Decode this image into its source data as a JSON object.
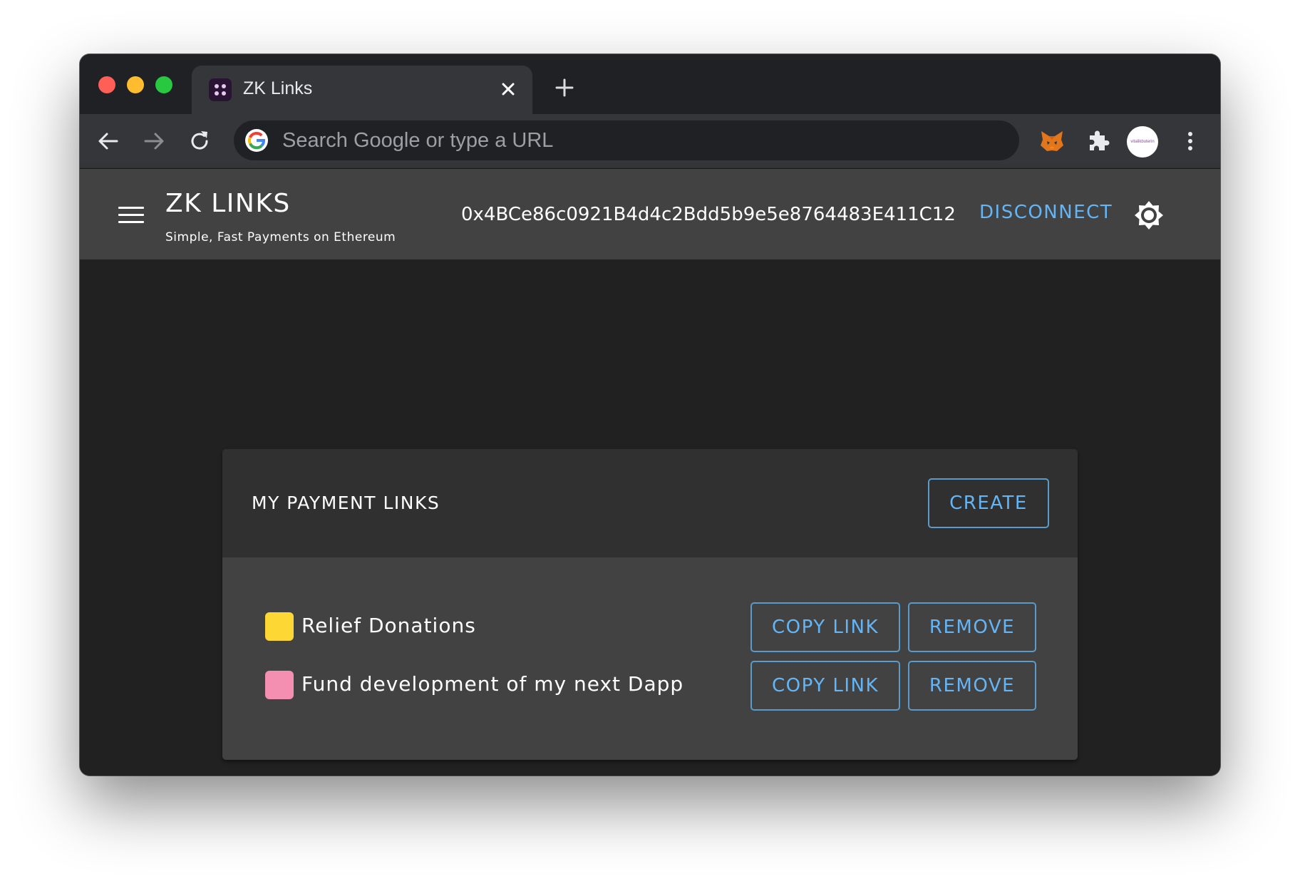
{
  "browser": {
    "tab_title": "ZK Links",
    "omnibox_placeholder": "Search Google or type a URL",
    "avatar_text": "vitalikbuterin"
  },
  "app": {
    "title": "ZK LINKS",
    "subtitle": "Simple, Fast Payments on Ethereum",
    "wallet_address": "0x4BCe86c0921B4d4c2Bdd5b9e5e8764483E411C12",
    "disconnect_label": "DISCONNECT"
  },
  "card": {
    "title": "MY PAYMENT LINKS",
    "create_label": "CREATE",
    "links": [
      {
        "name": "Relief Donations",
        "color": "#fdd835",
        "copy_label": "COPY LINK",
        "remove_label": "REMOVE"
      },
      {
        "name": "Fund development of my next Dapp",
        "color": "#f48fb1",
        "copy_label": "COPY LINK",
        "remove_label": "REMOVE"
      }
    ]
  },
  "colors": {
    "accent": "#64b5f6",
    "appbar": "#424242",
    "background": "#212121"
  },
  "icons": [
    "tab-favicon-icon",
    "close-icon",
    "plus-icon",
    "back-arrow-icon",
    "forward-arrow-icon",
    "reload-icon",
    "google-icon",
    "metamask-fox-icon",
    "puzzle-extensions-icon",
    "kebab-menu-icon",
    "hamburger-menu-icon",
    "brightness-icon"
  ]
}
